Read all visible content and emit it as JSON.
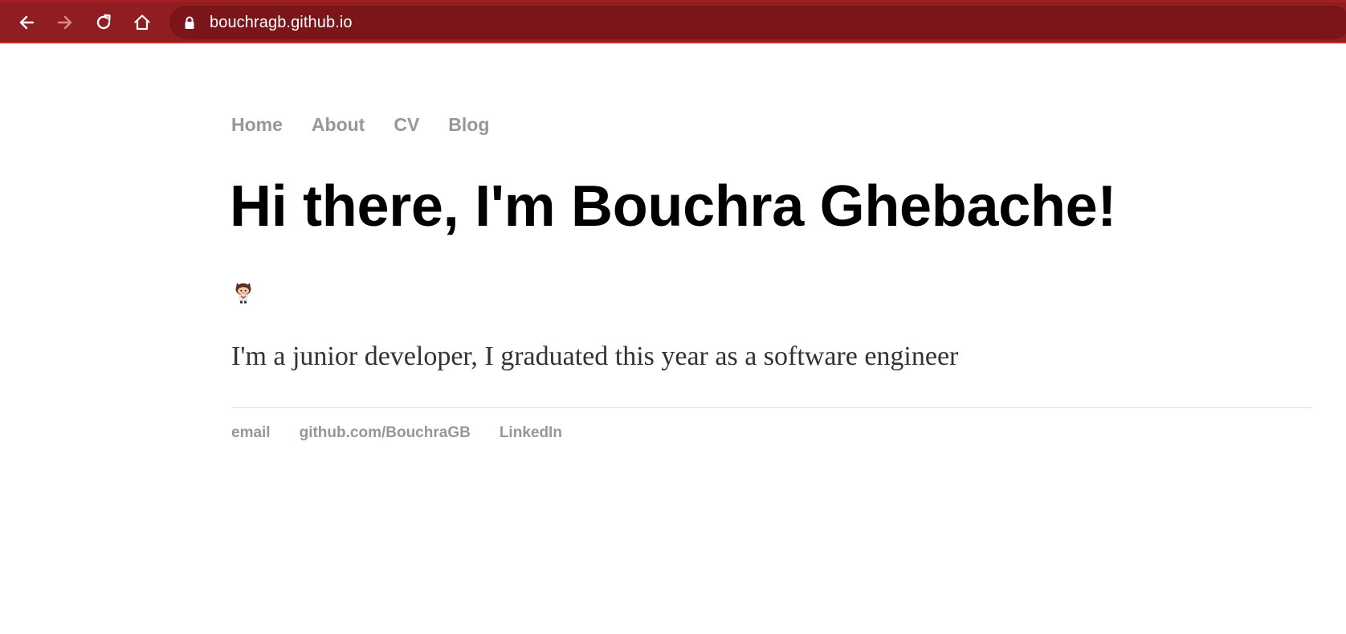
{
  "browser": {
    "url": "bouchragb.github.io",
    "toolbar_color": "#8f1d21",
    "omnibox_color": "#7a1519",
    "icons": {
      "back": "arrow-left-icon",
      "forward": "arrow-right-icon",
      "reload": "reload-icon",
      "home": "home-icon",
      "lock": "lock-icon"
    }
  },
  "nav": {
    "items": [
      {
        "label": "Home"
      },
      {
        "label": "About"
      },
      {
        "label": "CV"
      },
      {
        "label": "Blog"
      }
    ]
  },
  "main": {
    "title": "Hi there, I'm Bouchra Ghebache!",
    "avatar_icon": "octocat-girl-icon",
    "intro": "I'm a junior developer, I graduated this year as a software engineer"
  },
  "footer": {
    "links": [
      {
        "label": "email"
      },
      {
        "label": "github.com/BouchraGB"
      },
      {
        "label": "LinkedIn"
      }
    ]
  },
  "colors": {
    "link_gray": "#979797",
    "title_black": "#000000",
    "body_text": "#333333",
    "divider": "#dddddd"
  }
}
